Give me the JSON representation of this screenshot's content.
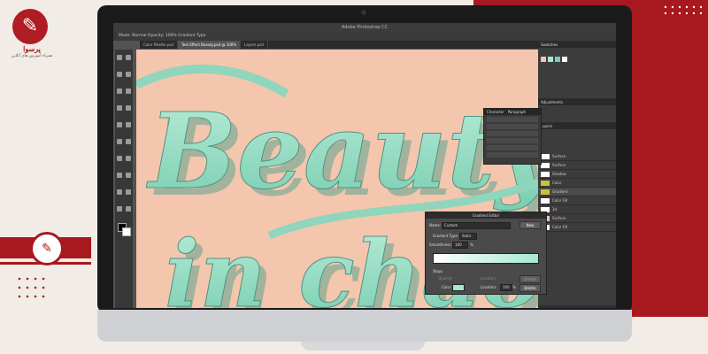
{
  "brand": {
    "logo_glyph": "✎",
    "name": "پرسوا",
    "tagline": "همراه آموزش های آنلاین",
    "accent": "#a8191f"
  },
  "screen": {
    "window_title": "Adobe Photoshop CC",
    "options_bar": "Mode: Normal   Opacity: 100%   Gradient Type",
    "tabs": [
      "Color Palette.psd",
      "Text Effect Beauty.psd @ 100%",
      "Layers.psd"
    ],
    "artwork_text_line1": "Beauty",
    "artwork_text_line2": "in chaos",
    "panels": {
      "swatches_title": "Swatches",
      "adjustments_title": "Adjustments",
      "layers_title": "Layers",
      "layers": [
        "Surface",
        "Surface",
        "Shadow",
        "Color",
        "Gradient",
        "Color Fill",
        "3d",
        "Surface",
        "Color Fill"
      ]
    },
    "character_panel": {
      "title": "Character",
      "tab2": "Paragraph"
    },
    "gradient_editor": {
      "title": "Gradient Editor",
      "name_label": "Name:",
      "name_value": "Custom",
      "new_button": "New",
      "type_label": "Gradient Type:",
      "type_value": "Solid",
      "smoothness_label": "Smoothness:",
      "smoothness_value": "100",
      "smoothness_unit": "%",
      "stops_label": "Stops",
      "opacity_label": "Opacity:",
      "location_label": "Location:",
      "delete_button": "Delete",
      "color_label": "Color:",
      "color_location_value": "100",
      "color_location_unit": "%",
      "delete_button_2": "Delete",
      "stop_color": "#a6e8cf"
    }
  }
}
